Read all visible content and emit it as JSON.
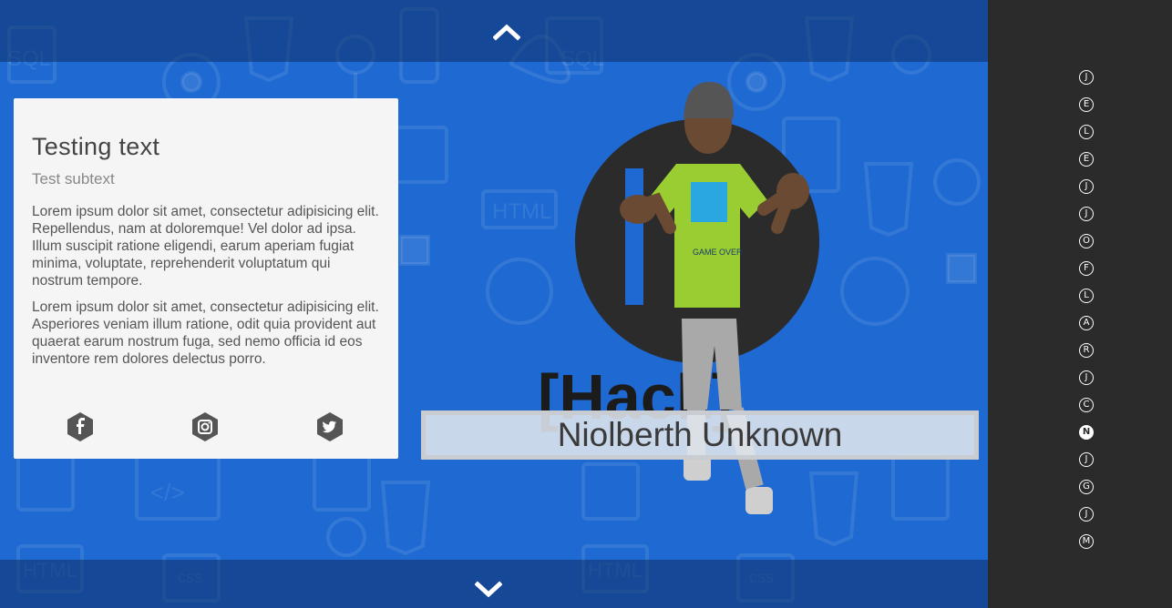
{
  "card": {
    "title": "Testing text",
    "subtitle": "Test subtext",
    "paragraphs": [
      "Lorem ipsum dolor sit amet, consectetur adipisicing elit. Repellendus, nam at doloremque! Vel dolor ad ipsa. Illum suscipit ratione eligendi, earum aperiam fugiat minima, voluptate, reprehenderit voluptatum qui nostrum tempore.",
      "Lorem ipsum dolor sit amet, consectetur adipisicing elit. Asperiores veniam illum ratione, odit quia provident aut quaerat earum nostrum fuga, sed nemo officia id eos inventore rem dolores delectus porro."
    ],
    "social": [
      "facebook-icon",
      "instagram-icon",
      "twitter-icon"
    ]
  },
  "hero": {
    "name": "Niolberth Unknown",
    "shirt_text": "GAME OVER",
    "logo_text": "[Hack]"
  },
  "navigation": {
    "up_icon": "chevron-up-icon",
    "down_icon": "chevron-down-icon"
  },
  "sidebar": {
    "letters": [
      "J",
      "E",
      "L",
      "E",
      "J",
      "J",
      "O",
      "F",
      "L",
      "A",
      "R",
      "J",
      "C",
      "N",
      "J",
      "G",
      "J",
      "M"
    ],
    "active_index": 13
  },
  "colors": {
    "background": "#1e69d2",
    "sidebar": "#2b2b2b",
    "card": "#f5f5f5",
    "shirt": "#9acd32"
  }
}
